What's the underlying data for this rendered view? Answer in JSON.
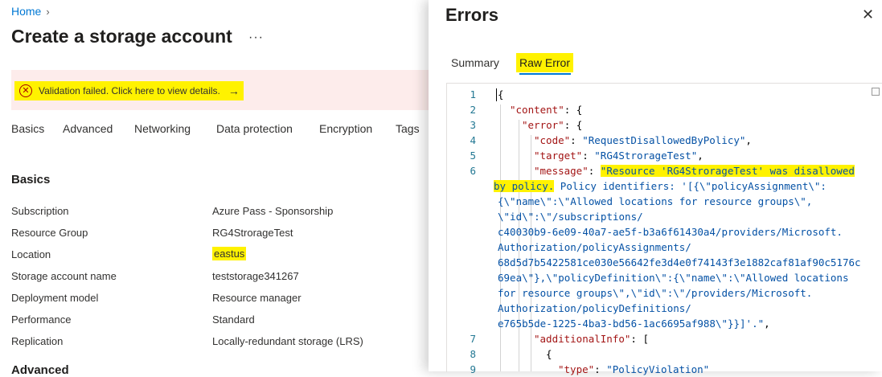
{
  "breadcrumb": {
    "home": "Home",
    "separator": "›"
  },
  "page": {
    "title": "Create a storage account",
    "more": "···"
  },
  "banner": {
    "text": "Validation failed. Click here to view details.",
    "icon": "error-circle-icon",
    "arrow": "→",
    "icon_glyph": "✕"
  },
  "tabs": [
    "Basics",
    "Advanced",
    "Networking",
    "Data protection",
    "Encryption",
    "Tags"
  ],
  "basics": {
    "heading": "Basics",
    "rows": [
      {
        "label": "Subscription",
        "value": "Azure Pass - Sponsorship"
      },
      {
        "label": "Resource Group",
        "value": "RG4StrorageTest"
      },
      {
        "label": "Location",
        "value": "eastus"
      },
      {
        "label": "Storage account name",
        "value": "teststorage341267"
      },
      {
        "label": "Deployment model",
        "value": "Resource manager"
      },
      {
        "label": "Performance",
        "value": "Standard"
      },
      {
        "label": "Replication",
        "value": "Locally-redundant storage (LRS)"
      }
    ],
    "next_heading": "Advanced"
  },
  "errors_panel": {
    "title": "Errors",
    "close": "✕",
    "tabs": {
      "summary": "Summary",
      "raw": "Raw Error"
    },
    "line_numbers": [
      "1",
      "2",
      "3",
      "4",
      "5",
      "6",
      "7",
      "8",
      "9"
    ],
    "code": {
      "l1": "{",
      "l2_key": "\"content\"",
      "l2_rest": ": {",
      "l3_key": "\"error\"",
      "l3_rest": ": {",
      "l4_key": "\"code\"",
      "l4_val": "\"RequestDisallowedByPolicy\"",
      "l4_end": ",",
      "l5_key": "\"target\"",
      "l5_val": "\"RG4StrorageTest\"",
      "l5_end": ",",
      "l6_key": "\"message\"",
      "l6_val_a": "\"Resource 'RG4StrorageTest' was disallowed",
      "w1": "by policy.",
      "w2": " Policy identifiers: '[{\\\"policyAssignment\\\":",
      "w3": "{\\\"name\\\":\\\"Allowed locations for resource groups\\\",",
      "w4": "\\\"id\\\":\\\"/subscriptions/",
      "w5": "c40030b9-6e09-40a7-ae5f-b3a6f61430a4/providers/Microsoft.",
      "w6": "Authorization/policyAssignments/",
      "w7": "68d5d7b5422581ce030e56642fe3d4e0f74143f3e1882caf81af90c5176c",
      "w8": "69ea\\\"},\\\"policyDefinition\\\":{\\\"name\\\":\\\"Allowed locations",
      "w9": "for resource groups\\\",\\\"id\\\":\\\"/providers/Microsoft.",
      "w10": "Authorization/policyDefinitions/",
      "w11": "e765b5de-1225-4ba3-bd56-1ac6695af988\\\"}}]'.\"",
      "w11_end": ",",
      "l7_key": "\"additionalInfo\"",
      "l7_rest": ": [",
      "l8": "{",
      "l9_key": "\"type\"",
      "l9_val": "\"PolicyViolation\""
    }
  },
  "colors": {
    "accent": "#0078d4",
    "highlight": "#fff200",
    "error": "#a80000",
    "banner_bg": "#fdeceb"
  }
}
